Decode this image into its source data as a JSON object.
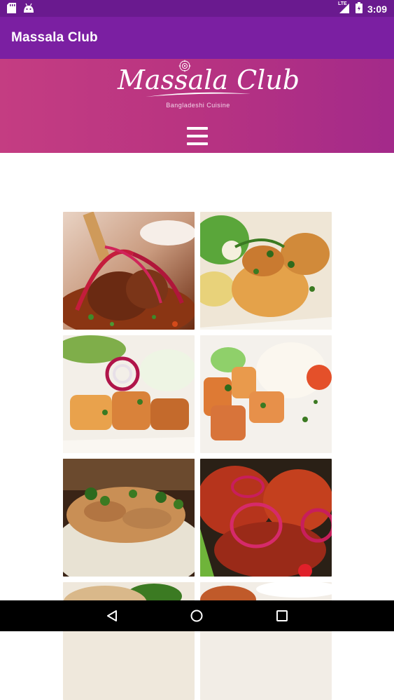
{
  "status_bar": {
    "time": "3:09",
    "network": "LTE",
    "left_icons": [
      "sd-card-icon",
      "android-icon"
    ]
  },
  "app_bar": {
    "title": "Massala Club"
  },
  "banner": {
    "logo_text": "Massala Club",
    "tagline": "Bangladeshi Cuisine",
    "menu_icon": "hamburger-menu-icon"
  },
  "gallery": {
    "tiles": [
      {
        "dish": "lamb-shank-with-onion-rings"
      },
      {
        "dish": "chicken-tikka-with-salad"
      },
      {
        "dish": "paneer-tikka-with-onion"
      },
      {
        "dish": "chicken-tikka-with-rice"
      },
      {
        "dish": "curry-over-rice"
      },
      {
        "dish": "tandoori-chicken-with-onion"
      },
      {
        "dish": "plated-dish-partial"
      },
      {
        "dish": "plated-dish-partial"
      }
    ]
  },
  "navigation": {
    "back": "back-icon",
    "home": "home-icon",
    "recents": "recents-icon"
  },
  "colors": {
    "status_bar": "#6a1a8f",
    "app_bar": "#7b1fa2",
    "banner": "#b83381"
  }
}
